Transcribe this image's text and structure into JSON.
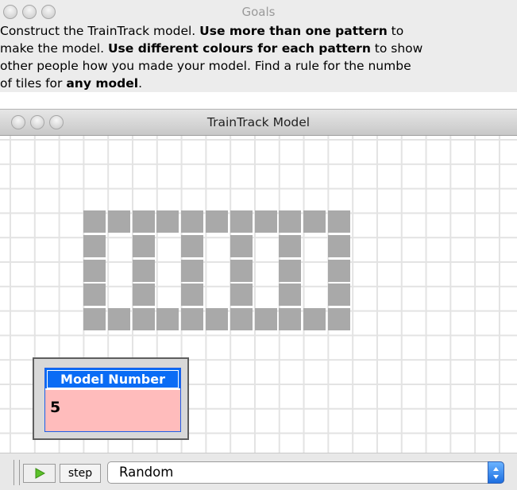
{
  "goals_window": {
    "title": "Goals",
    "text_lines": [
      [
        {
          "t": "Construct the TrainTrack model. ",
          "b": false
        },
        {
          "t": "Use more than one pattern",
          "b": true
        },
        {
          "t": " to",
          "b": false
        }
      ],
      [
        {
          "t": "make the model. ",
          "b": false
        },
        {
          "t": "Use different colours for each pattern",
          "b": true
        },
        {
          "t": " to show",
          "b": false
        }
      ],
      [
        {
          "t": "other people how you made your model. Find a rule for the numbe",
          "b": false
        }
      ],
      [
        {
          "t": "of tiles for ",
          "b": false
        },
        {
          "t": "any model",
          "b": true
        },
        {
          "t": ".",
          "b": false
        }
      ]
    ]
  },
  "model_window": {
    "title": "TrainTrack Model",
    "tile_color": "#a9a9a9",
    "model_number": {
      "label": "Model Number",
      "value": "5"
    }
  },
  "controls": {
    "play_icon": "play-icon",
    "step_label": "step",
    "mode_selected": "Random"
  }
}
